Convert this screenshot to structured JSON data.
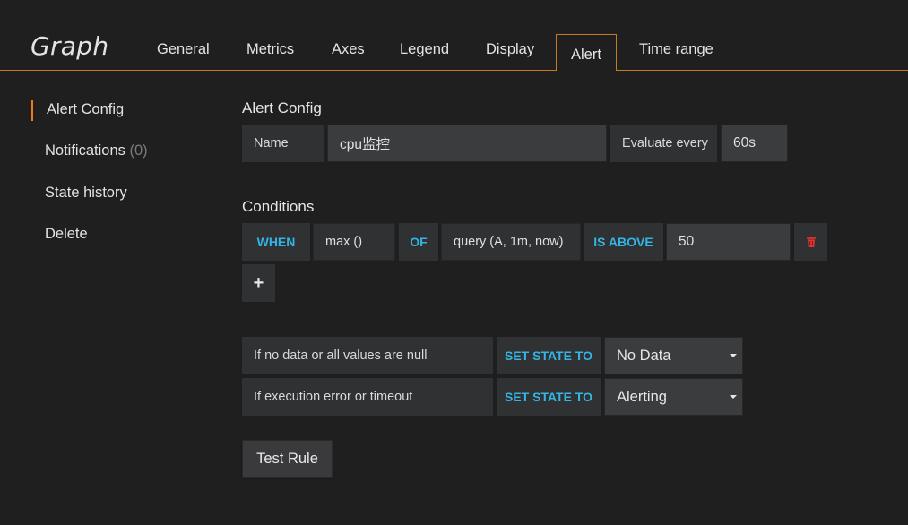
{
  "header": {
    "title": "Graph",
    "tabs": [
      "General",
      "Metrics",
      "Axes",
      "Legend",
      "Display",
      "Alert",
      "Time range"
    ],
    "active_tab": "Alert"
  },
  "sidebar": {
    "items": [
      {
        "label": "Alert Config"
      },
      {
        "label": "Notifications",
        "count": "(0)"
      },
      {
        "label": "State history"
      },
      {
        "label": "Delete"
      }
    ]
  },
  "alert_config": {
    "title": "Alert Config",
    "name_label": "Name",
    "name_value": "cpu监控",
    "evaluate_label": "Evaluate every",
    "evaluate_value": "60s"
  },
  "conditions": {
    "title": "Conditions",
    "when": "WHEN",
    "reducer": "max ()",
    "of": "OF",
    "query": "query (A, 1m, now)",
    "evaluator": "IS ABOVE",
    "threshold": "50",
    "add_icon": "plus-icon",
    "delete_icon": "trash-icon"
  },
  "no_data": {
    "label": "If no data or all values are null",
    "set_state": "SET STATE TO",
    "value": "No Data"
  },
  "exec_error": {
    "label": "If execution error or timeout",
    "set_state": "SET STATE TO",
    "value": "Alerting"
  },
  "actions": {
    "test_rule": "Test Rule"
  },
  "colors": {
    "accent": "#eb7b18",
    "keyword": "#33b5e5",
    "background": "#1f1f20",
    "trash": "#e9302f"
  }
}
